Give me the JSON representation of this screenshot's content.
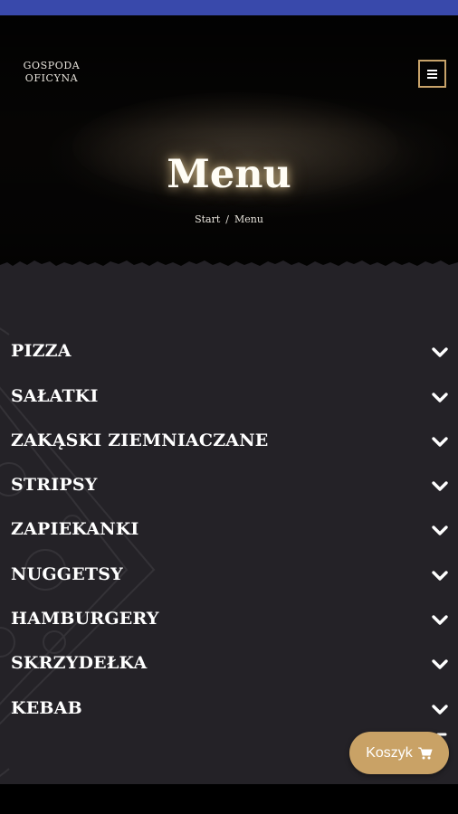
{
  "brand": {
    "line1": "GOSPODA",
    "line2": "OFICYNA"
  },
  "header": {
    "menu_icon": "hamburger-icon"
  },
  "hero": {
    "title": "Menu"
  },
  "breadcrumb": {
    "home": "Start",
    "separator": "/",
    "current": "Menu"
  },
  "categories": [
    {
      "label": "PIZZA",
      "icon": "chevron-down-icon"
    },
    {
      "label": "SAŁATKI",
      "icon": "chevron-down-icon"
    },
    {
      "label": "ZAKĄSKI ZIEMNIACZANE",
      "icon": "chevron-down-icon"
    },
    {
      "label": "STRIPSY",
      "icon": "chevron-down-icon"
    },
    {
      "label": "ZAPIEKANKI",
      "icon": "chevron-down-icon"
    },
    {
      "label": "NUGGETSY",
      "icon": "chevron-down-icon"
    },
    {
      "label": "HAMBURGERY",
      "icon": "chevron-down-icon"
    },
    {
      "label": "SKRZYDEŁKA",
      "icon": "chevron-down-icon"
    },
    {
      "label": "KEBAB",
      "icon": "chevron-down-icon"
    }
  ],
  "cart": {
    "label": "Koszyk",
    "icon": "cart-icon"
  },
  "colors": {
    "accent": "#c9a266",
    "status_bar": "#3949ab",
    "content_bg": "#242227",
    "menu_border": "#c8a36a"
  }
}
